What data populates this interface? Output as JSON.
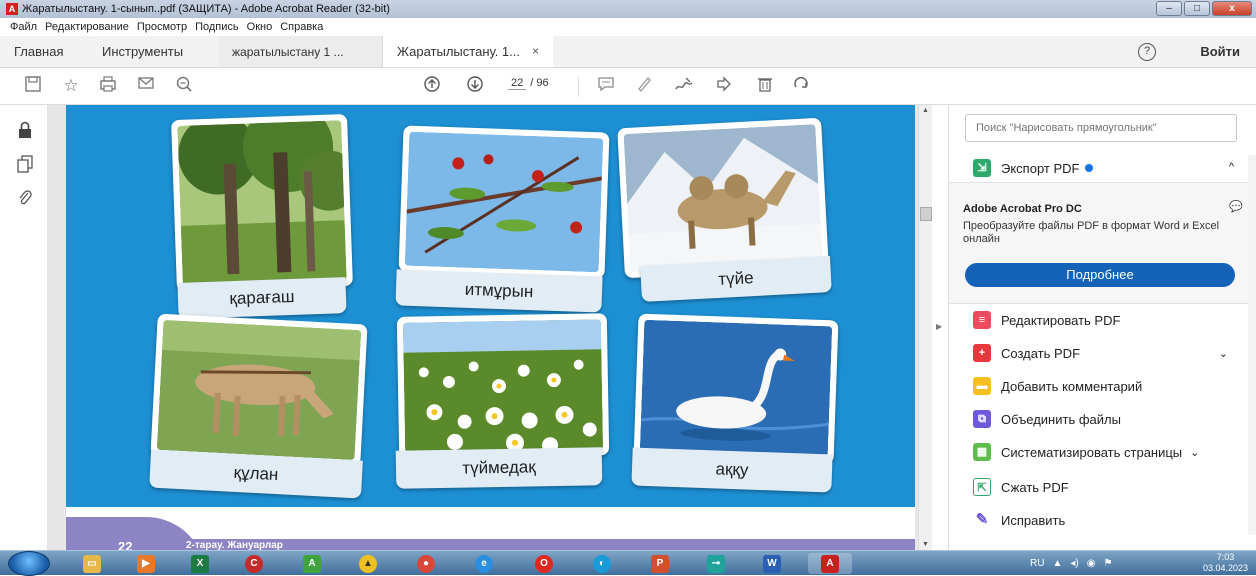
{
  "window": {
    "title": "Жаратылыстану. 1-сынып..pdf (ЗАЩИТА) - Adobe Acrobat Reader (32-bit)",
    "min": "–",
    "max": "□",
    "close": "x"
  },
  "menu": [
    "Файл",
    "Редактирование",
    "Просмотр",
    "Подпись",
    "Окно",
    "Справка"
  ],
  "tabs": {
    "home": "Главная",
    "tools": "Инструменты",
    "doc1": "жаратылыстану 1 ...",
    "doc2": "Жаратылыстану. 1...",
    "close": "×"
  },
  "header": {
    "help": "?",
    "login": "Войти"
  },
  "toolbar": {
    "current_page": "22",
    "total_pages": "/ 96"
  },
  "page": {
    "cards": [
      "қарағаш",
      "итмұрын",
      "түйе",
      "құлан",
      "түймедақ",
      "аққу"
    ],
    "page_number": "22",
    "section": "2-тарау. Жануарлар"
  },
  "right_panel": {
    "search_placeholder": "Поиск \"Нарисовать прямоугольник\"",
    "export": "Экспорт PDF",
    "promo_title": "Adobe Acrobat Pro DC",
    "promo_desc": "Преобразуйте файлы PDF в формат Word и Excel онлайн",
    "promo_button": "Подробнее",
    "tools": [
      "Редактировать PDF",
      "Создать PDF",
      "Добавить комментарий",
      "Объединить файлы",
      "Систематизировать страницы",
      "Сжать PDF",
      "Исправить"
    ]
  },
  "taskbar": {
    "lang": "RU",
    "time": "7:03",
    "date": "03.04.2023"
  },
  "colors": {
    "page_bg": "#1d8fd3",
    "accent": "#1463b8",
    "section": "#8d84c4"
  }
}
